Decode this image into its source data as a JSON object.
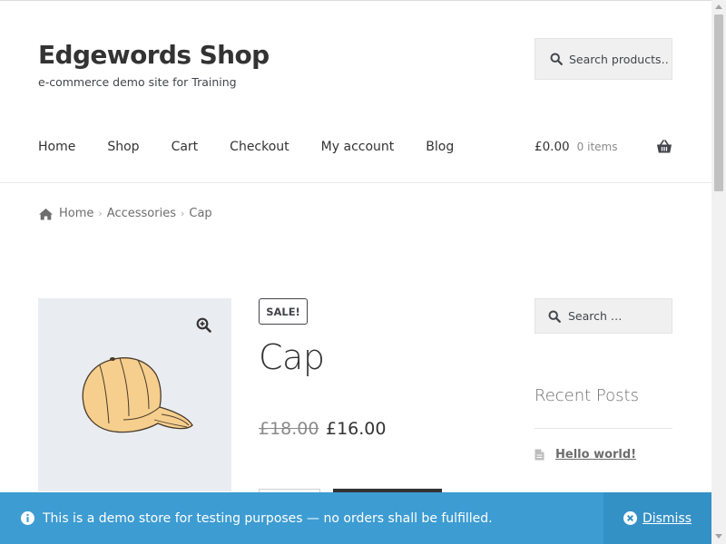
{
  "site": {
    "title": "Edgewords Shop",
    "description": "e-commerce demo site for Training"
  },
  "header_search": {
    "placeholder": "Search products…",
    "icon": "search-icon"
  },
  "nav": {
    "items": [
      {
        "label": "Home"
      },
      {
        "label": "Shop"
      },
      {
        "label": "Cart"
      },
      {
        "label": "Checkout"
      },
      {
        "label": "My account"
      },
      {
        "label": "Blog"
      }
    ]
  },
  "cart": {
    "amount": "£0.00",
    "count": "0 items",
    "icon": "basket-icon"
  },
  "breadcrumb": {
    "home": "Home",
    "category": "Accessories",
    "current": "Cap",
    "separator": "›"
  },
  "product": {
    "badge": "SALE!",
    "title": "Cap",
    "price_old": "£18.00",
    "price_new": "£16.00",
    "image_icon": "cap-image",
    "zoom_icon": "zoom-icon"
  },
  "sidebar": {
    "search_placeholder": "Search …",
    "recent_title": "Recent Posts",
    "recent_posts": [
      {
        "label": "Hello world!"
      }
    ]
  },
  "notice": {
    "text": "This is a demo store for testing purposes — no orders shall be fulfilled.",
    "dismiss_label": "Dismiss"
  },
  "colors": {
    "notice_bg": "#3d9cd2",
    "dismiss_bg": "#3491c6",
    "text_dark": "#333333",
    "gallery_bg": "#e9edf1"
  }
}
